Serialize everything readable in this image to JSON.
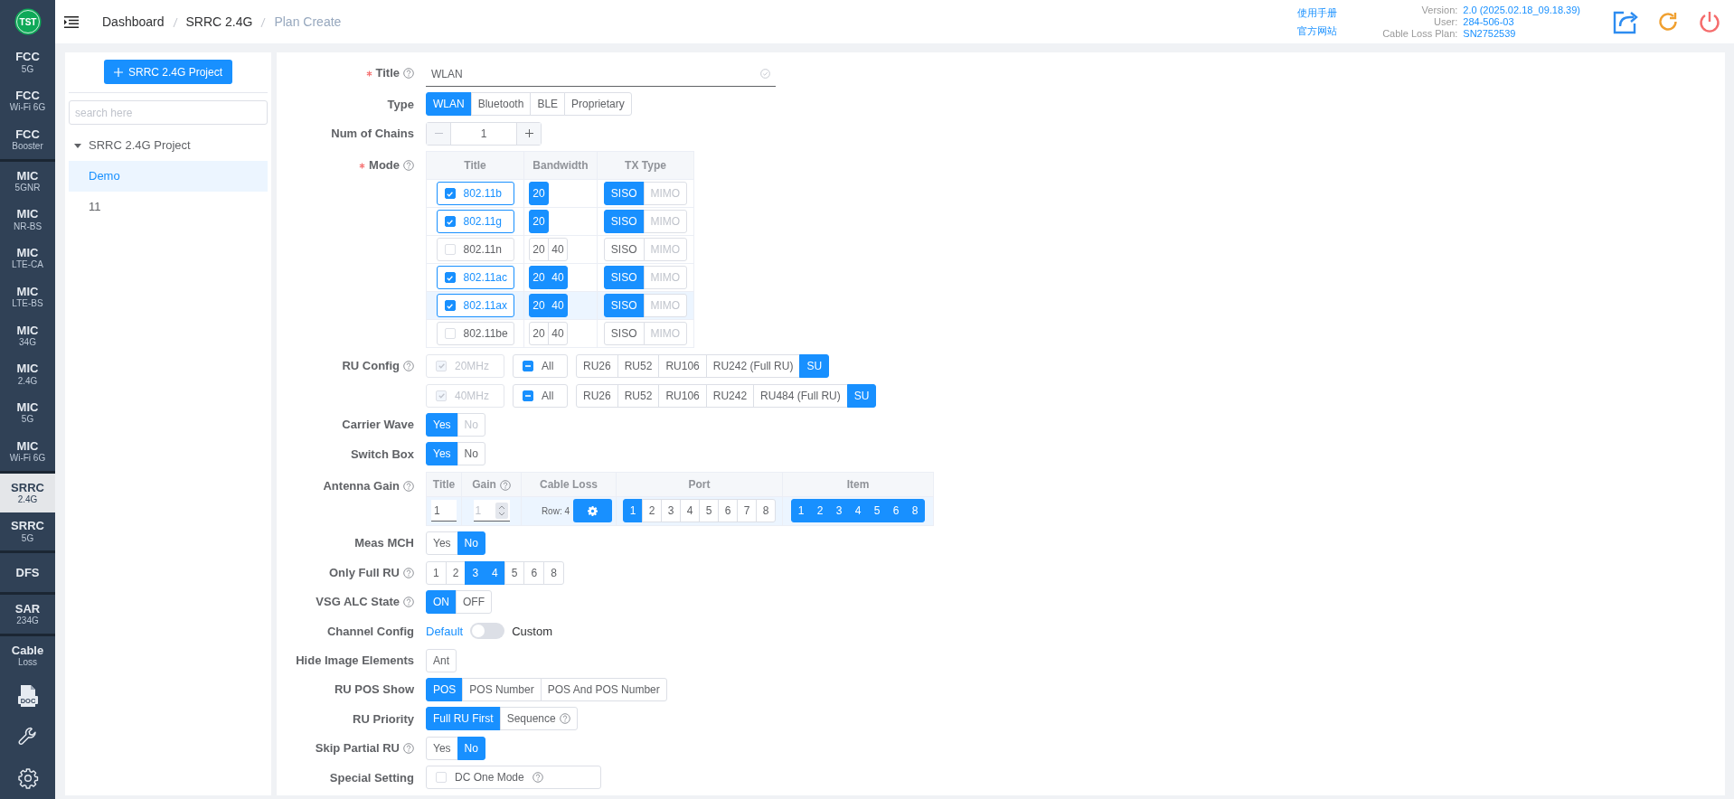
{
  "logo": "TST",
  "sidebar": {
    "groups": [
      {
        "items": [
          {
            "title": "FCC",
            "subtitle": "5G",
            "selected": false
          },
          {
            "title": "FCC",
            "subtitle": "Wi-Fi 6G",
            "selected": false
          },
          {
            "title": "FCC",
            "subtitle": "Booster",
            "selected": false
          }
        ]
      },
      {
        "items": [
          {
            "title": "MIC",
            "subtitle": "5GNR",
            "selected": false
          },
          {
            "title": "MIC",
            "subtitle": "NR-BS",
            "selected": false
          },
          {
            "title": "MIC",
            "subtitle": "LTE-CA",
            "selected": false
          },
          {
            "title": "MIC",
            "subtitle": "LTE-BS",
            "selected": false
          },
          {
            "title": "MIC",
            "subtitle": "34G",
            "selected": false
          },
          {
            "title": "MIC",
            "subtitle": "2.4G",
            "selected": false
          },
          {
            "title": "MIC",
            "subtitle": "5G",
            "selected": false
          },
          {
            "title": "MIC",
            "subtitle": "Wi-Fi 6G",
            "selected": false
          }
        ]
      },
      {
        "items": [
          {
            "title": "SRRC",
            "subtitle": "2.4G",
            "selected": true
          },
          {
            "title": "SRRC",
            "subtitle": "5G",
            "selected": false
          }
        ]
      },
      {
        "items": [
          {
            "title": "DFS",
            "selected": false
          }
        ]
      },
      {
        "items": [
          {
            "title": "SAR",
            "subtitle": "234G",
            "selected": false
          }
        ]
      },
      {
        "items": [
          {
            "title": "Cable",
            "subtitle": "Loss",
            "selected": false
          }
        ]
      }
    ],
    "tools": [
      {
        "kind": "doc",
        "text": "DOC"
      },
      {
        "kind": "wrench"
      },
      {
        "kind": "settings"
      }
    ]
  },
  "breadcrumb": [
    {
      "label": "Dashboard",
      "current": false
    },
    {
      "label": "SRRC 2.4G",
      "current": false
    },
    {
      "label": "Plan Create",
      "current": true
    }
  ],
  "header": {
    "links": [
      "使用手册",
      "官方网站"
    ],
    "info": [
      {
        "label": "Version:",
        "value": "2.0 (2025.02.18_09.18.39)"
      },
      {
        "label": "User:",
        "value": "284-506-03"
      },
      {
        "label": "Cable Loss Plan:",
        "value": "SN2752539"
      }
    ]
  },
  "tree": {
    "add_button": "SRRC 2.4G Project",
    "search_placeholder": "search here",
    "root": {
      "label": "SRRC 2.4G Project",
      "expanded": true,
      "children": [
        {
          "label": "Demo",
          "selected": true
        },
        {
          "label": "11",
          "selected": false
        }
      ]
    }
  },
  "form": {
    "rows": [
      {
        "kind": "text",
        "label": "Title",
        "required": true,
        "help": true,
        "value": "WLAN",
        "valid": true
      },
      {
        "kind": "segmented",
        "label": "Type",
        "options": [
          {
            "label": "WLAN",
            "selected": true
          },
          {
            "label": "Bluetooth",
            "selected": false
          },
          {
            "label": "BLE",
            "selected": false
          },
          {
            "label": "Proprietary",
            "selected": false
          }
        ]
      },
      {
        "kind": "stepper",
        "label": "Num of Chains",
        "value": "1",
        "decrement_disabled": true
      },
      {
        "kind": "mode_table",
        "label": "Mode",
        "required": true,
        "help": true,
        "columns": [
          "Title",
          "Bandwidth",
          "TX Type"
        ],
        "rows": [
          {
            "title": "802.11b",
            "checked": true,
            "highlighted": false,
            "bandwidths": [
              {
                "label": "20",
                "selected": true
              }
            ],
            "tx": [
              {
                "label": "SISO",
                "selected": true,
                "disabled": false
              },
              {
                "label": "MIMO",
                "selected": false,
                "disabled": true
              }
            ]
          },
          {
            "title": "802.11g",
            "checked": true,
            "highlighted": false,
            "bandwidths": [
              {
                "label": "20",
                "selected": true
              }
            ],
            "tx": [
              {
                "label": "SISO",
                "selected": true,
                "disabled": false
              },
              {
                "label": "MIMO",
                "selected": false,
                "disabled": true
              }
            ]
          },
          {
            "title": "802.11n",
            "checked": false,
            "highlighted": false,
            "bandwidths": [
              {
                "label": "20",
                "selected": false
              },
              {
                "label": "40",
                "selected": false
              }
            ],
            "tx": [
              {
                "label": "SISO",
                "selected": false,
                "disabled": false
              },
              {
                "label": "MIMO",
                "selected": false,
                "disabled": true
              }
            ]
          },
          {
            "title": "802.11ac",
            "checked": true,
            "highlighted": false,
            "bandwidths": [
              {
                "label": "20",
                "selected": true
              },
              {
                "label": "40",
                "selected": true
              }
            ],
            "tx": [
              {
                "label": "SISO",
                "selected": true,
                "disabled": false
              },
              {
                "label": "MIMO",
                "selected": false,
                "disabled": true
              }
            ]
          },
          {
            "title": "802.11ax",
            "checked": true,
            "highlighted": true,
            "bandwidths": [
              {
                "label": "20",
                "selected": true
              },
              {
                "label": "40",
                "selected": true
              }
            ],
            "tx": [
              {
                "label": "SISO",
                "selected": true,
                "disabled": false
              },
              {
                "label": "MIMO",
                "selected": false,
                "disabled": true
              }
            ]
          },
          {
            "title": "802.11be",
            "checked": false,
            "highlighted": false,
            "bandwidths": [
              {
                "label": "20",
                "selected": false
              },
              {
                "label": "40",
                "selected": false
              }
            ],
            "tx": [
              {
                "label": "SISO",
                "selected": false,
                "disabled": false
              },
              {
                "label": "MIMO",
                "selected": false,
                "disabled": true
              }
            ]
          }
        ]
      },
      {
        "kind": "ru_config",
        "label": "RU Config",
        "help": true,
        "lines": [
          {
            "bandwidth": {
              "label": "20MHz",
              "checked": true,
              "disabled": true
            },
            "all": {
              "label": "All",
              "indeterminate": true
            },
            "options": [
              {
                "label": "RU26",
                "selected": false
              },
              {
                "label": "RU52",
                "selected": false
              },
              {
                "label": "RU106",
                "selected": false
              },
              {
                "label": "RU242 (Full RU)",
                "selected": false
              },
              {
                "label": "SU",
                "selected": true
              }
            ]
          },
          {
            "bandwidth": {
              "label": "40MHz",
              "checked": true,
              "disabled": true
            },
            "all": {
              "label": "All",
              "indeterminate": true
            },
            "options": [
              {
                "label": "RU26",
                "selected": false
              },
              {
                "label": "RU52",
                "selected": false
              },
              {
                "label": "RU106",
                "selected": false
              },
              {
                "label": "RU242",
                "selected": false
              },
              {
                "label": "RU484 (Full RU)",
                "selected": false
              },
              {
                "label": "SU",
                "selected": true
              }
            ]
          }
        ]
      },
      {
        "kind": "segmented",
        "label": "Carrier Wave",
        "options": [
          {
            "label": "Yes",
            "selected": true,
            "disabled": false
          },
          {
            "label": "No",
            "selected": false,
            "disabled": true
          }
        ]
      },
      {
        "kind": "segmented",
        "label": "Switch Box",
        "options": [
          {
            "label": "Yes",
            "selected": true
          },
          {
            "label": "No",
            "selected": false
          }
        ]
      },
      {
        "kind": "antenna_table",
        "label": "Antenna Gain",
        "help": true,
        "columns": [
          {
            "label": "Title"
          },
          {
            "label": "Gain",
            "help": true
          },
          {
            "label": "Cable Loss"
          },
          {
            "label": "Port"
          },
          {
            "label": "Item"
          }
        ],
        "rows": [
          {
            "title": "1",
            "gain": "1",
            "gain_disabled": true,
            "cable_loss": "Row: 4",
            "ports": [
              {
                "label": "1",
                "selected": true
              },
              {
                "label": "2",
                "selected": false
              },
              {
                "label": "3",
                "selected": false
              },
              {
                "label": "4",
                "selected": false
              },
              {
                "label": "5",
                "selected": false
              },
              {
                "label": "6",
                "selected": false
              },
              {
                "label": "7",
                "selected": false
              },
              {
                "label": "8",
                "selected": false
              }
            ],
            "items": [
              {
                "label": "1",
                "selected": true
              },
              {
                "label": "2",
                "selected": true
              },
              {
                "label": "3",
                "selected": true
              },
              {
                "label": "4",
                "selected": true
              },
              {
                "label": "5",
                "selected": true
              },
              {
                "label": "6",
                "selected": true
              },
              {
                "label": "8",
                "selected": true
              }
            ]
          }
        ]
      },
      {
        "kind": "segmented",
        "label": "Meas MCH",
        "options": [
          {
            "label": "Yes",
            "selected": false
          },
          {
            "label": "No",
            "selected": true
          }
        ]
      },
      {
        "kind": "segmented",
        "label": "Only Full RU",
        "help": true,
        "options": [
          {
            "label": "1",
            "selected": false
          },
          {
            "label": "2",
            "selected": false
          },
          {
            "label": "3",
            "selected": true
          },
          {
            "label": "4",
            "selected": true
          },
          {
            "label": "5",
            "selected": false
          },
          {
            "label": "6",
            "selected": false
          },
          {
            "label": "8",
            "selected": false
          }
        ]
      },
      {
        "kind": "segmented",
        "label": "VSG ALC State",
        "help": true,
        "options": [
          {
            "label": "ON",
            "selected": true
          },
          {
            "label": "OFF",
            "selected": false
          }
        ]
      },
      {
        "kind": "switch",
        "label": "Channel Config",
        "off_label": "Default",
        "on_label": "Custom",
        "on": false
      },
      {
        "kind": "segmented",
        "label": "Hide Image Elements",
        "options": [
          {
            "label": "Ant",
            "selected": false
          }
        ]
      },
      {
        "kind": "segmented",
        "label": "RU POS Show",
        "options": [
          {
            "label": "POS",
            "selected": true
          },
          {
            "label": "POS Number",
            "selected": false
          },
          {
            "label": "POS And POS Number",
            "selected": false
          }
        ]
      },
      {
        "kind": "segmented",
        "label": "RU Priority",
        "options": [
          {
            "label": "Full RU First",
            "selected": true,
            "help": false
          },
          {
            "label": "Sequence",
            "selected": false,
            "help": true
          }
        ]
      },
      {
        "kind": "segmented",
        "label": "Skip Partial RU",
        "help": true,
        "options": [
          {
            "label": "Yes",
            "selected": false
          },
          {
            "label": "No",
            "selected": true
          }
        ]
      },
      {
        "kind": "checkbox_group",
        "label": "Special Setting",
        "options": [
          {
            "label": "DC One Mode",
            "checked": false,
            "help": true
          }
        ]
      }
    ]
  }
}
